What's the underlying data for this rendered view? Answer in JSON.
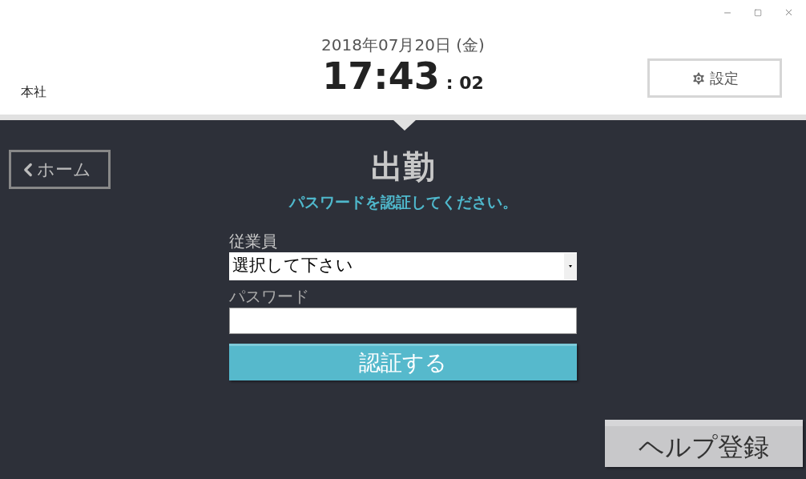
{
  "header": {
    "location": "本社",
    "date": "2018年07月20日 (金)",
    "time": "17:43",
    "seconds": ": 02",
    "settings_button": "設定"
  },
  "home_button": "ホーム",
  "title": "出勤",
  "instruction": "パスワードを認証してください。",
  "form": {
    "employee_label": "従業員",
    "employee_select": {
      "value": "選択して下さい"
    },
    "password_label": "パスワード",
    "submit_button": "認証する"
  },
  "help_button": "ヘルプ登録"
}
